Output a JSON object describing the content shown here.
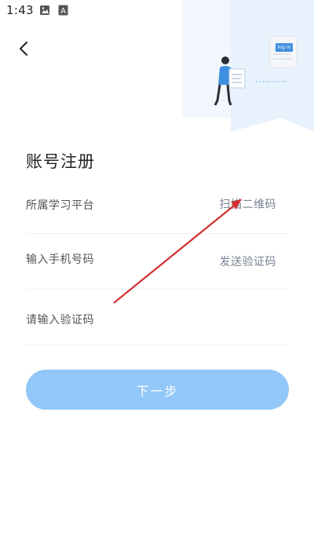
{
  "status_bar": {
    "time": "1:43"
  },
  "hero": {
    "login_tag": "log in"
  },
  "form": {
    "title": "账号注册",
    "platform": {
      "label": "所属学习平台",
      "action": "扫描二维码"
    },
    "phone": {
      "placeholder": "输入手机号码",
      "action": "发送验证码"
    },
    "code": {
      "placeholder": "请输入验证码"
    },
    "next_label": "下一步"
  },
  "colors": {
    "accent": "#91c8f7",
    "annotation": "#d32f2f",
    "hero_bg": "#e8f2fc",
    "hero_figure": "#3f8fe0"
  }
}
